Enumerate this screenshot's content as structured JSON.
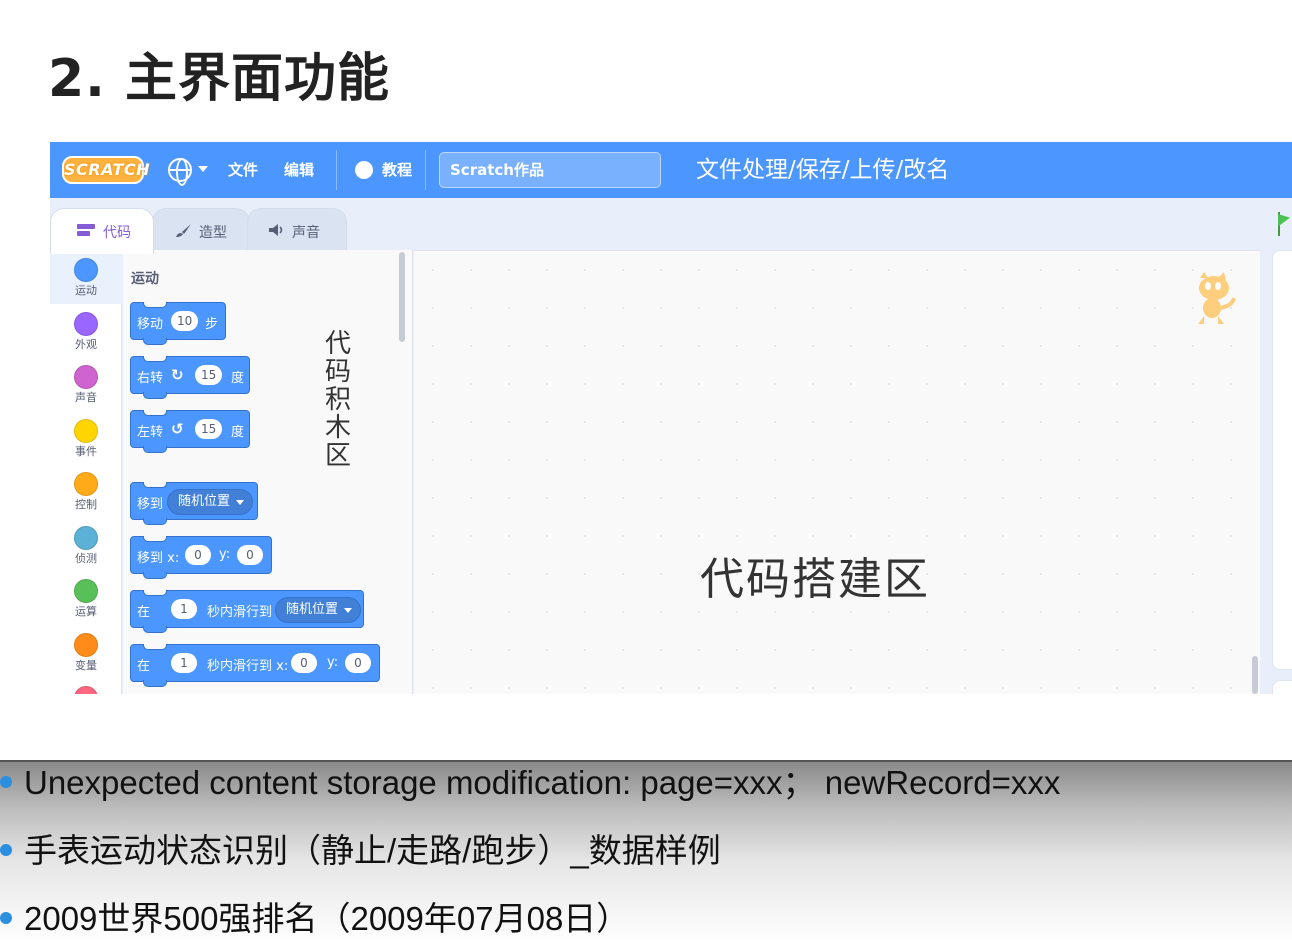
{
  "slide": {
    "title": "2. 主界面功能"
  },
  "menubar": {
    "logo": "SCRATCH",
    "file": "文件",
    "edit": "编辑",
    "tutorials": "教程",
    "project_title": "Scratch作品",
    "annotation": "文件处理/保存/上传/改名",
    "icons": [
      "globe-icon",
      "chevron-down-icon",
      "lightbulb-icon"
    ]
  },
  "tabs": [
    {
      "label": "代码",
      "icon": "code-blocks-icon",
      "active": true
    },
    {
      "label": "造型",
      "icon": "paintbrush-icon",
      "active": false
    },
    {
      "label": "声音",
      "icon": "speaker-icon",
      "active": false
    }
  ],
  "categories": [
    {
      "label": "运动",
      "color": "#4c97ff"
    },
    {
      "label": "外观",
      "color": "#9966ff"
    },
    {
      "label": "声音",
      "color": "#cf63cf"
    },
    {
      "label": "事件",
      "color": "#ffd500"
    },
    {
      "label": "控制",
      "color": "#ffab19"
    },
    {
      "label": "侦测",
      "color": "#5cb1d6"
    },
    {
      "label": "运算",
      "color": "#59c059"
    },
    {
      "label": "变量",
      "color": "#ff8c1a"
    }
  ],
  "palette": {
    "heading": "运动",
    "annotation": [
      "代",
      "码",
      "积",
      "木",
      "区"
    ],
    "blocks": {
      "move": {
        "pre": "移动",
        "value": "10",
        "post": "步"
      },
      "turn_right": {
        "pre": "右转",
        "icon": "rotate-right-icon",
        "value": "15",
        "post": "度"
      },
      "turn_left": {
        "pre": "左转",
        "icon": "rotate-left-icon",
        "value": "15",
        "post": "度"
      },
      "goto": {
        "pre": "移到",
        "dropdown": "随机位置"
      },
      "goto_xy": {
        "pre": "移到 x:",
        "x": "0",
        "ylabel": "y:",
        "y": "0"
      },
      "glide": {
        "pre": "在",
        "secs": "1",
        "mid": "秒内滑行到",
        "dropdown": "随机位置"
      },
      "glide_xy": {
        "pre": "在",
        "secs": "1",
        "mid": "秒内滑行到 x:",
        "x": "0",
        "ylabel": "y:",
        "y": "0"
      }
    }
  },
  "workspace": {
    "annotation": "代码搭建区",
    "sprite": "cat-sprite-icon"
  },
  "colors": {
    "menubar": "#4c97ff",
    "motion": "#4c97ff",
    "bullet": "#2b8fe0"
  },
  "bullets": [
    "Unexpected content storage modification: page=xxx； newRecord=xxx",
    "手表运动状态识别（静止/走路/跑步）_数据样例",
    "2009世界500强排名（2009年07月08日）"
  ]
}
